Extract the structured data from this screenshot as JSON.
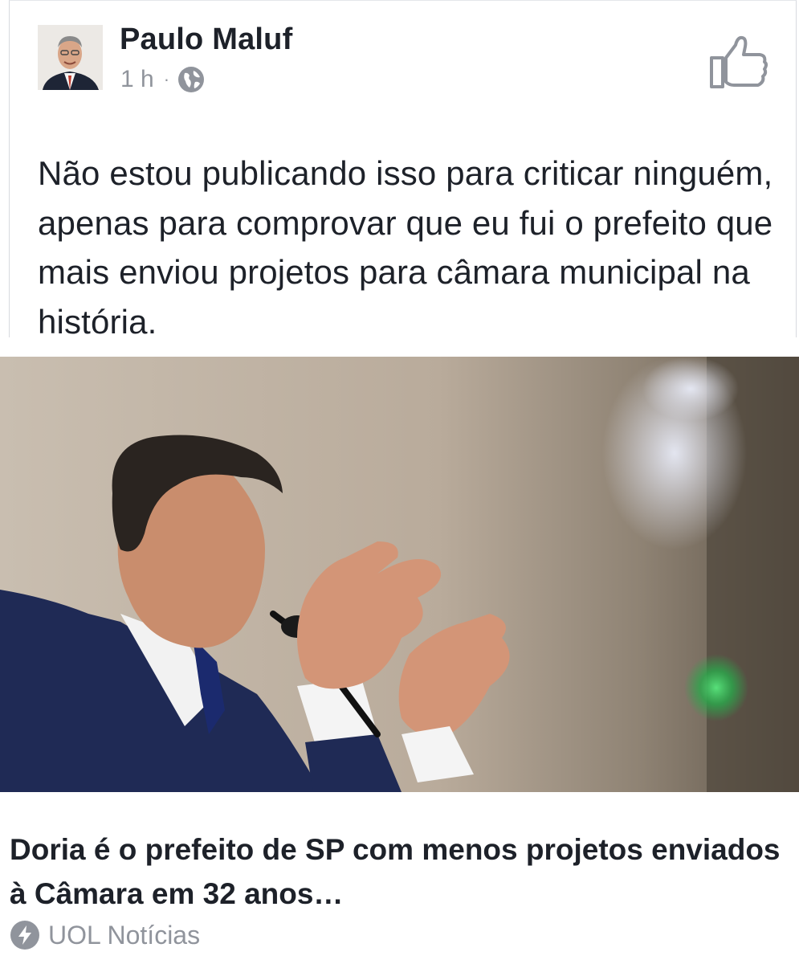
{
  "post": {
    "author": "Paulo Maluf",
    "time": "1 h",
    "separator": "·",
    "privacy_icon": "globe-icon",
    "action_icon": "thumbs-up-icon",
    "text": "Não estou publicando isso para criticar ninguém, apenas para comprovar que eu fui o prefeito que mais enviou projetos para câmara municipal na história."
  },
  "link": {
    "headline": "Doria é o prefeito de SP com menos projetos enviados à Câmara em 32 anos…",
    "source_icon": "lightning-bolt-icon",
    "source": "UOL Notícias"
  },
  "colors": {
    "text": "#1d2129",
    "meta": "#90949c",
    "border": "#d8dadf"
  }
}
